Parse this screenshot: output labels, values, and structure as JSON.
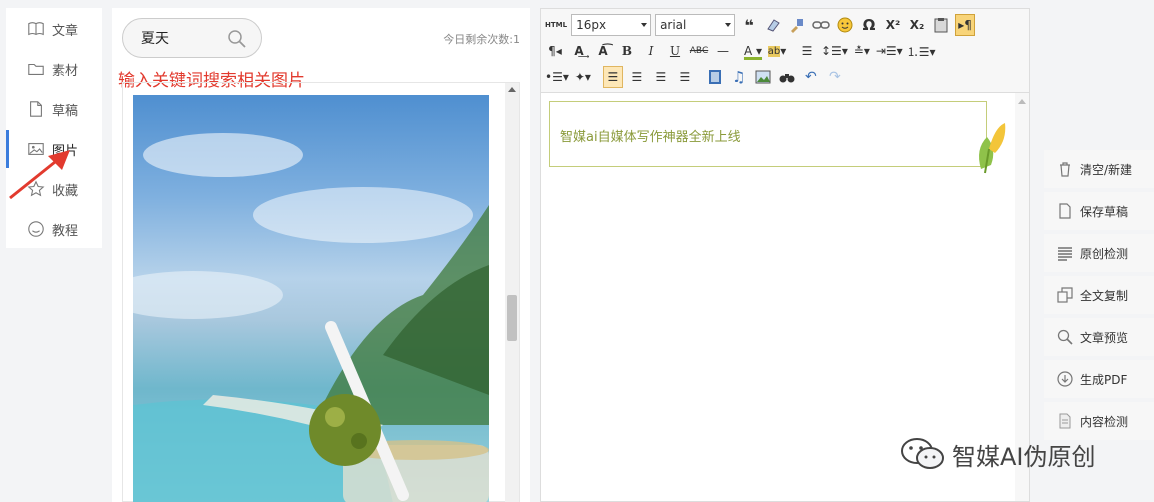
{
  "sidebar": {
    "items": [
      {
        "label": "文章",
        "icon": "book-icon"
      },
      {
        "label": "素材",
        "icon": "folder-icon"
      },
      {
        "label": "草稿",
        "icon": "document-icon"
      },
      {
        "label": "图片",
        "icon": "image-icon",
        "active": true
      },
      {
        "label": "收藏",
        "icon": "star-icon"
      },
      {
        "label": "教程",
        "icon": "smile-icon"
      }
    ]
  },
  "image_panel": {
    "search_value": "夏天",
    "remaining_label": "今日剩余次数:1",
    "annotation": "输入关键词搜索相关图片"
  },
  "editor": {
    "font_size": "16px",
    "font_family": "arial",
    "html_label": "HTML",
    "content_text": "智媒ai自媒体写作神器全新上线"
  },
  "actions": [
    {
      "label": "清空/新建",
      "icon": "trash-icon"
    },
    {
      "label": "保存草稿",
      "icon": "document-icon"
    },
    {
      "label": "原创检测",
      "icon": "lines-icon"
    },
    {
      "label": "全文复制",
      "icon": "copy-icon"
    },
    {
      "label": "文章预览",
      "icon": "magnifier-icon"
    },
    {
      "label": "生成PDF",
      "icon": "download-icon"
    },
    {
      "label": "内容检测",
      "icon": "file-icon"
    }
  ],
  "watermark": "智媒AI伪原创",
  "colors": {
    "accent": "#3b7ddd",
    "annotation": "#e23a2e",
    "content_border": "#c4cd7a",
    "content_text": "#8a9a3a"
  }
}
